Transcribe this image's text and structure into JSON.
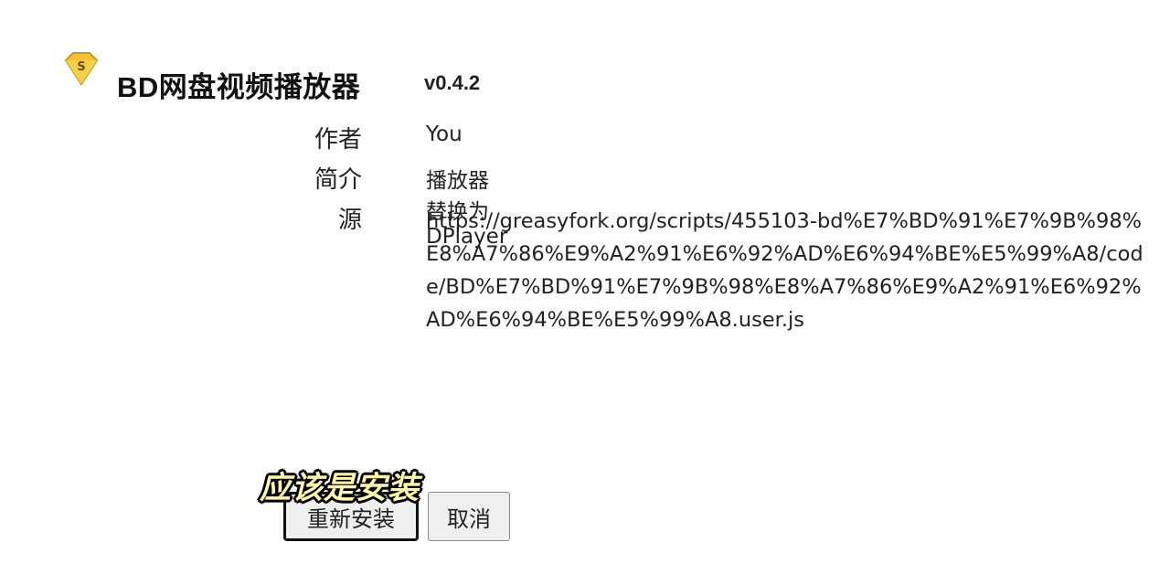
{
  "header": {
    "logo_icon": "sparkle-diamond-icon",
    "logo_glyph": "S",
    "title": "BD网盘视频播放器",
    "version": "v0.4.2"
  },
  "details": {
    "author_label": "作者",
    "author_value": "You",
    "description_label": "简介",
    "description_value": "播放器替换为DPlayer",
    "source_label": "源",
    "source_value": "https://greasyfork.org/scripts/455103-bd%E7%BD%91%E7%9B%98%E8%A7%86%E9%A2%91%E6%92%AD%E6%94%BE%E5%99%A8/code/BD%E7%BD%91%E7%9B%98%E8%A7%86%E9%A2%91%E6%92%AD%E6%94%BE%E5%99%A8.user.js"
  },
  "actions": {
    "reinstall_label": "重新安装",
    "cancel_label": "取消"
  },
  "overlay": {
    "caption": "应该是安装"
  },
  "colors": {
    "logo_fill": "#f4c430",
    "logo_stroke": "#c9961a",
    "caption_fill": "#fff8a8"
  }
}
